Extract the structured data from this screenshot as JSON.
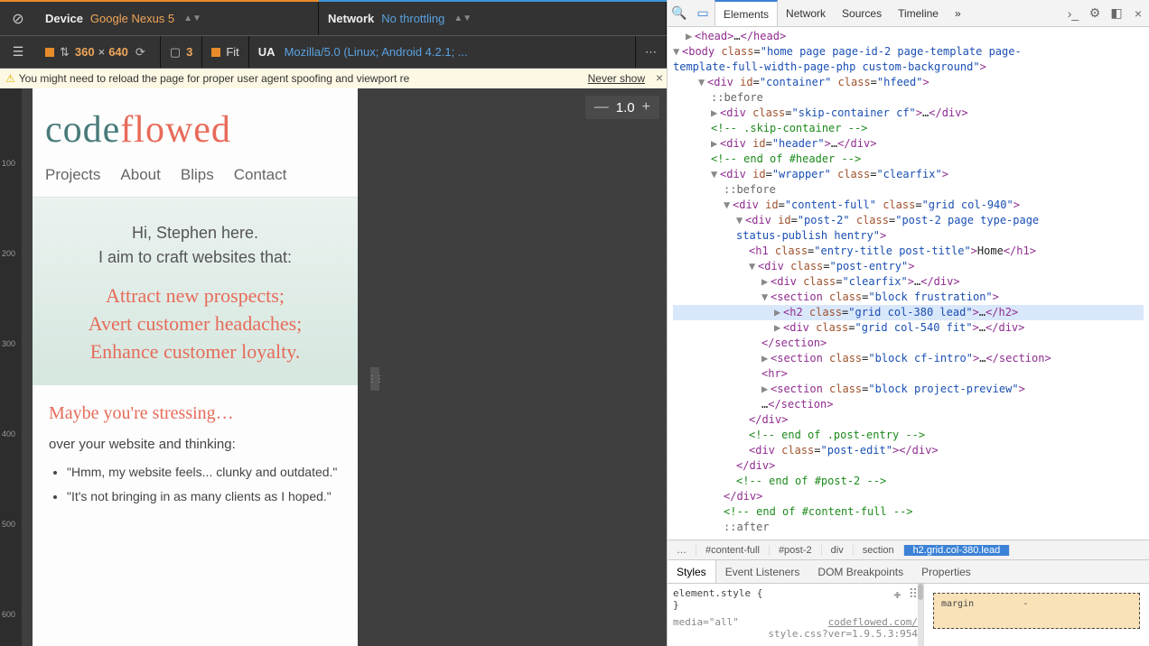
{
  "toolbar": {
    "device_label": "Device",
    "device_value": "Google Nexus 5",
    "network_label": "Network",
    "network_value": "No throttling",
    "dims_w": "360",
    "dims_x": "×",
    "dims_h": "640",
    "dpr": "3",
    "fit_label": "Fit",
    "ua_label": "UA",
    "ua_value": "Mozilla/5.0 (Linux; Android 4.2.1; ...",
    "more": "⋯"
  },
  "warning": {
    "text": "You might need to reload the page for proper user agent spoofing and viewport re",
    "link": "Never show",
    "close": "×"
  },
  "zoom": {
    "minus": "—",
    "value": "1.0",
    "plus": "+"
  },
  "ruler_v": [
    "100",
    "200",
    "300",
    "400",
    "500",
    "600"
  ],
  "mobile": {
    "logo_a": "code",
    "logo_b": "flowed",
    "nav": [
      "Projects",
      "About",
      "Blips",
      "Contact"
    ],
    "hi_1": "Hi, Stephen here.",
    "hi_2": "I aim to craft websites that:",
    "p1": "Attract new prospects;",
    "p2": "Avert customer headaches;",
    "p3": "Enhance customer loyalty.",
    "stress_h": "Maybe you're stressing…",
    "stress_p": "over your website and thinking:",
    "li1": "\"Hmm, my website feels... clunky and outdated.\"",
    "li2": "\"It's not bringing in as many clients as I hoped.\""
  },
  "devtabs": {
    "elements": "Elements",
    "network": "Network",
    "sources": "Sources",
    "timeline": "Timeline",
    "more": "»"
  },
  "crumbs": {
    "dots": "…",
    "c1": "#content-full",
    "c2": "#post-2",
    "c3": "div",
    "c4": "section",
    "sel": "h2.grid.col-380.lead"
  },
  "styletabs": {
    "styles": "Styles",
    "el": "Event Listeners",
    "dbp": "DOM Breakpoints",
    "prop": "Properties"
  },
  "styles": {
    "line1": "element.style {",
    "line2": "}",
    "line3": "media=\"all\"",
    "codelink": "codeflowed.com/",
    "line4": "style.css?ver=1.9.5.3:954",
    "margin": "margin",
    "dash": "-"
  },
  "dom": {
    "head": "<head>…</head>",
    "body": "<body class=\"home page page-id-2 page-template page-template-full-width-page-php custom-background\">",
    "container": "<div id=\"container\" class=\"hfeed\">",
    "before": "::before",
    "skip": "<div class=\"skip-container cf\">…</div>",
    "skipc": "<!-- .skip-container -->",
    "header": "<div id=\"header\">…</div>",
    "headerc": "<!-- end of #header -->",
    "wrapper": "<div id=\"wrapper\" class=\"clearfix\">",
    "cfull": "<div id=\"content-full\" class=\"grid col-940\">",
    "post2": "<div id=\"post-2\" class=\"post-2 page type-page status-publish hentry\">",
    "h1": "<h1 class=\"entry-title post-title\">Home</h1>",
    "pentry": "<div class=\"post-entry\">",
    "clearfix": "<div class=\"clearfix\">…</div>",
    "secfrust": "<section class=\"block frustration\">",
    "h2hl": "<h2 class=\"grid col-380 lead\">…</h2>",
    "fitdiv": "<div class=\"grid col-540 fit\">…</div>",
    "secend": "</section>",
    "secintro": "<section class=\"block cf-intro\">…</section>",
    "hr": "<hr>",
    "secproj": "<section class=\"block project-preview\">",
    "secprojend": "…</section>",
    "divend": "</div>",
    "pentryc": "<!-- end of .post-entry -->",
    "pedit": "<div class=\"post-edit\"></div>",
    "post2c": "<!-- end of #post-2 -->",
    "cfullc": "<!-- end of #content-full -->",
    "after": "::after"
  }
}
